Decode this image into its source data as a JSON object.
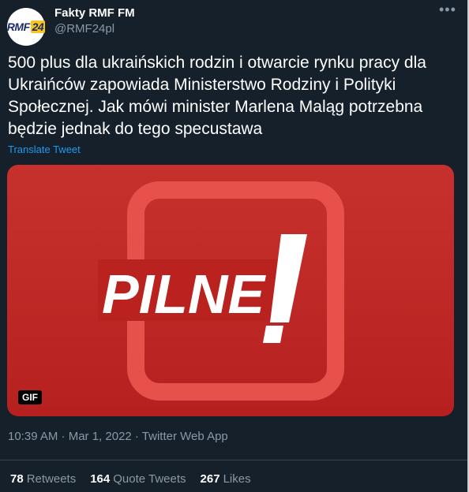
{
  "account": {
    "display_name": "Fakty RMF FM",
    "handle": "@RMF24pl",
    "avatar_logo_text": "RMF",
    "avatar_logo_number": "24"
  },
  "tweet": {
    "text": "500 plus dla ukraińskich rodzin i otwarcie rynku pracy dla Ukraińców zapowiada Ministerstwo Rodziny i Polityki Społecznej. Jak mówi minister Marlena Maląg potrzebna będzie jednak do tego specustawa",
    "translate_label": "Translate Tweet",
    "more_icon": "more-icon"
  },
  "media": {
    "banner_text": "PILNE",
    "exclamation": "!",
    "gif_badge": "GIF",
    "colors": {
      "background": "#b6201f",
      "frame": "#e8504c"
    }
  },
  "meta": {
    "line": "10:39 AM · Mar 1, 2022 · Twitter Web App"
  },
  "stats": {
    "retweets_count": "78",
    "retweets_label": "Retweets",
    "quotes_count": "164",
    "quotes_label": "Quote Tweets",
    "likes_count": "267",
    "likes_label": "Likes"
  }
}
